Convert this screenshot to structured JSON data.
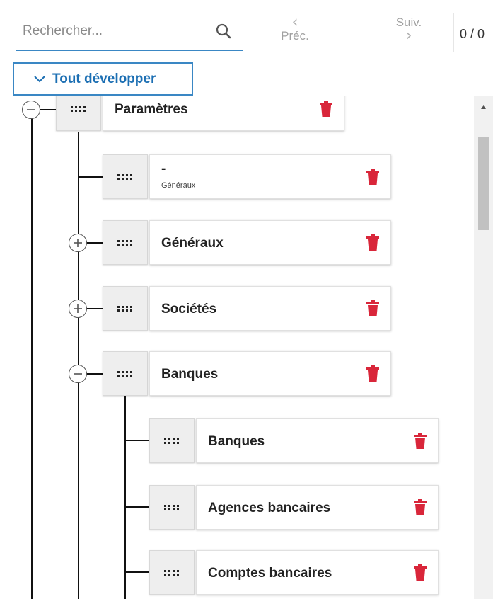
{
  "toolbar": {
    "search_placeholder": "Rechercher...",
    "prev_label": "Préc.",
    "next_label": "Suiv.",
    "counter": "0 / 0",
    "expand_all_label": "Tout développer"
  },
  "colors": {
    "accent": "#3a87c4",
    "delete": "#d9263a"
  },
  "tree": {
    "root": {
      "title": "Paramètres",
      "toggle": "collapse"
    },
    "children": [
      {
        "title": "-",
        "subtitle": "Généraux"
      },
      {
        "title": "Généraux",
        "toggle": "expand"
      },
      {
        "title": "Sociétés",
        "toggle": "expand"
      },
      {
        "title": "Banques",
        "toggle": "collapse",
        "children": [
          {
            "title": "Banques"
          },
          {
            "title": "Agences bancaires"
          },
          {
            "title": "Comptes bancaires"
          }
        ]
      }
    ]
  },
  "icons": {
    "search": "search-icon",
    "expand_all": "chevron-down-icon",
    "drag": "drag-handle-icon",
    "delete": "trash-icon",
    "expand": "plus-circle-icon",
    "collapse": "minus-circle-icon"
  }
}
